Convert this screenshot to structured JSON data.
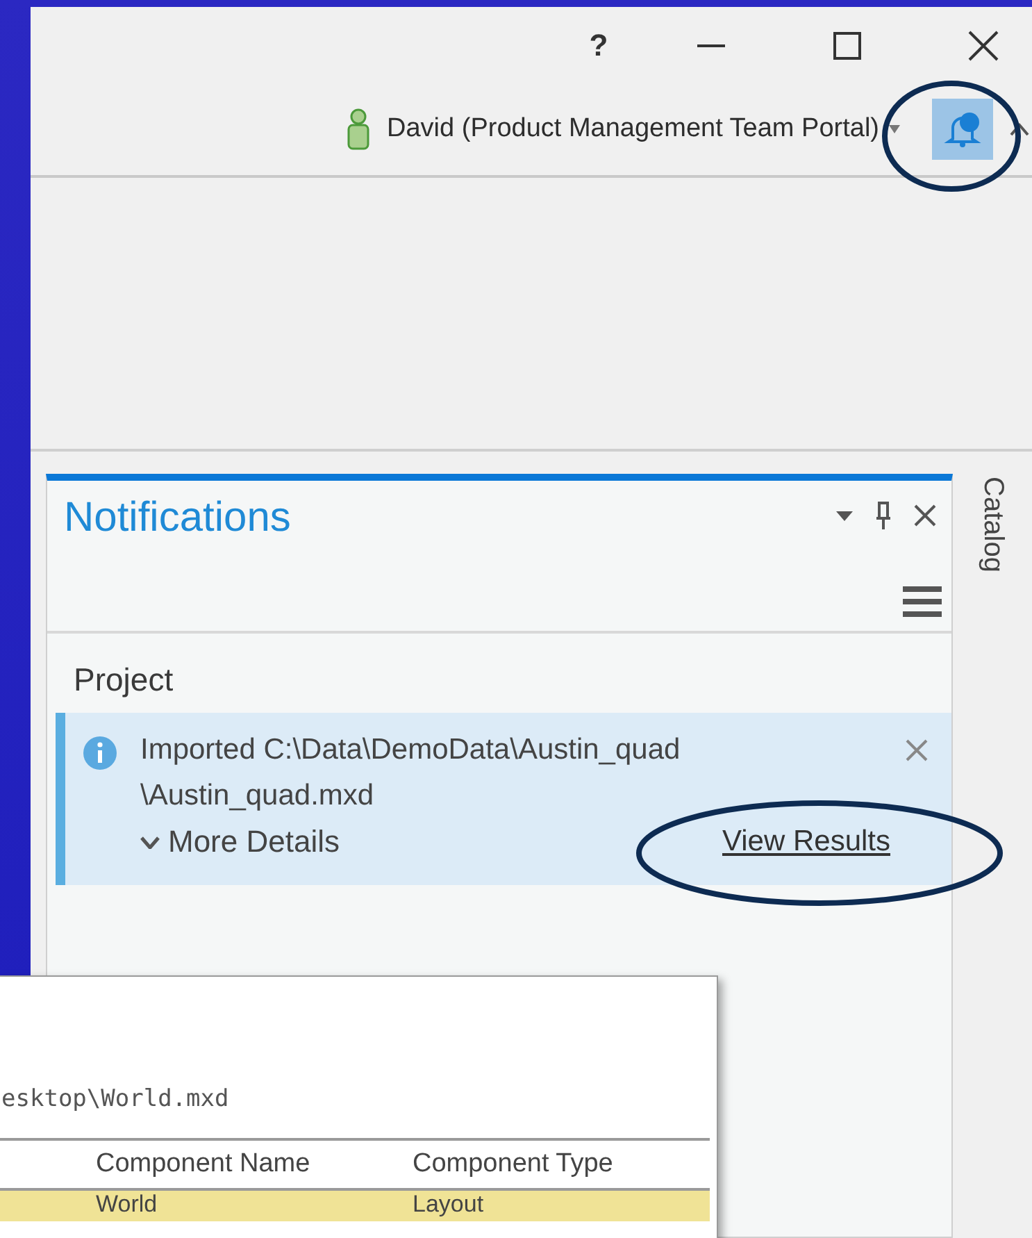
{
  "window": {
    "help": "?"
  },
  "account": {
    "name": "David (Product Management Team Portal)",
    "notifications_active": true
  },
  "notifications_pane": {
    "title": "Notifications",
    "section": "Project",
    "items": [
      {
        "kind": "info",
        "message": "Imported C:\\Data\\DemoData\\Austin_quad\n\\Austin_quad.mxd",
        "details": "More Details",
        "expanded": false,
        "action": "View Results"
      }
    ]
  },
  "side_tabs": [
    {
      "label": "Catalog"
    }
  ],
  "dialog": {
    "path": "esktop\\World.mxd",
    "columns": [
      "Component Name",
      "Component Type"
    ],
    "rows": [
      {
        "cells": [
          "World",
          "Layout"
        ],
        "selected": true
      }
    ]
  }
}
